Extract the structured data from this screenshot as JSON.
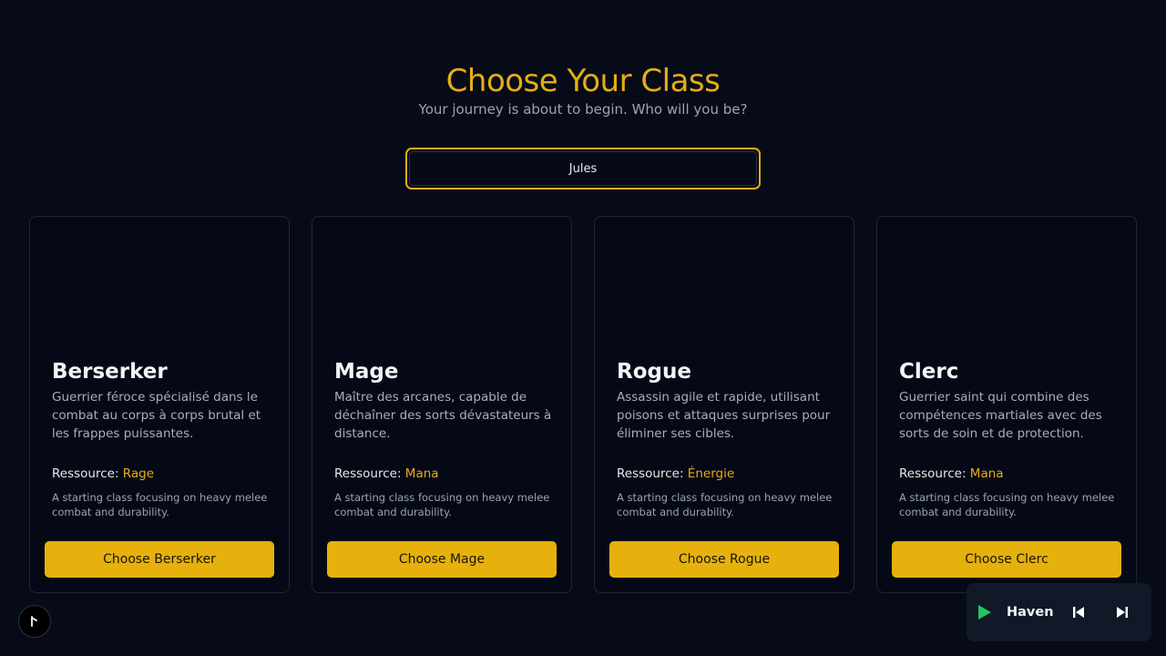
{
  "header": {
    "title": "Choose Your Class",
    "subtitle": "Your journey is about to begin. Who will you be?"
  },
  "name_field": {
    "value": "Jules"
  },
  "resource_label": "Ressource:",
  "classes": [
    {
      "name": "Berserker",
      "description": "Guerrier féroce spécialisé dans le combat au corps à corps brutal et les frappes puissantes.",
      "resource": "Rage",
      "note": "A starting class focusing on heavy melee combat and durability.",
      "button": "Choose Berserker"
    },
    {
      "name": "Mage",
      "description": "Maître des arcanes, capable de déchaîner des sorts dévastateurs à distance.",
      "resource": "Mana",
      "note": "A starting class focusing on heavy melee combat and durability.",
      "button": "Choose Mage"
    },
    {
      "name": "Rogue",
      "description": "Assassin agile et rapide, utilisant poisons et attaques surprises pour éliminer ses cibles.",
      "resource": "Énergie",
      "note": "A starting class focusing on heavy melee combat and durability.",
      "button": "Choose Rogue"
    },
    {
      "name": "Clerc",
      "description": "Guerrier saint qui combine des compétences martiales avec des sorts de soin et de protection.",
      "resource": "Mana",
      "note": "A starting class focusing on heavy melee combat and durability.",
      "button": "Choose Clerc"
    }
  ],
  "player": {
    "track": "Haven",
    "play_icon": "play-icon",
    "prev_icon": "skip-previous-icon",
    "next_icon": "skip-next-icon"
  },
  "corner_icon": "cursor-icon",
  "colors": {
    "background": "#070b18",
    "accent": "#e6ad16",
    "button": "#e6b10c",
    "play": "#22c55e"
  }
}
